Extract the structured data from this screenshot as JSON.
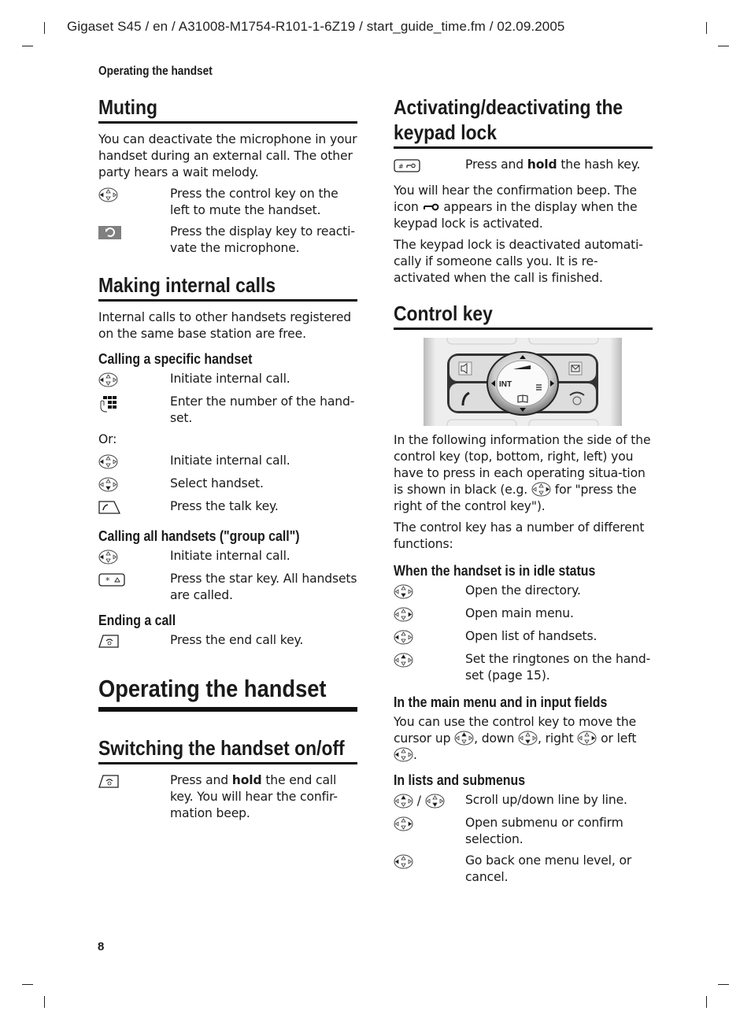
{
  "page_header": "Gigaset S45 / en / A31008-M1754-R101-1-6Z19 / start_guide_time.fm / 02.09.2005",
  "running_head": "Operating the handset",
  "page_number": "8",
  "left": {
    "muting": {
      "title": "Muting",
      "intro": "You can deactivate the microphone in your handset during an external call. The other party hears a wait melody.",
      "steps": [
        {
          "icon": "control-key-left-icon",
          "text": "Press the control key on the left to mute the handset."
        },
        {
          "icon": "display-key-back-icon",
          "text": "Press the display key to reacti-vate the microphone."
        }
      ]
    },
    "internal": {
      "title": "Making internal calls",
      "intro": "Internal calls to other handsets registered on the same base station are free.",
      "specific": {
        "title": "Calling a specific handset",
        "steps": [
          {
            "icon": "control-key-left-icon",
            "text": "Initiate internal call."
          },
          {
            "icon": "keypad-icon",
            "text": "Enter the number of the hand-set."
          }
        ],
        "or": "Or:",
        "steps2": [
          {
            "icon": "control-key-left-icon",
            "text": "Initiate internal call."
          },
          {
            "icon": "control-key-down-icon",
            "text": "Select handset."
          },
          {
            "icon": "talk-key-icon",
            "text": "Press the talk key."
          }
        ]
      },
      "group": {
        "title": "Calling all handsets (\"group call\")",
        "steps": [
          {
            "icon": "control-key-left-icon",
            "text": "Initiate internal call."
          },
          {
            "icon": "star-key-icon",
            "text": "Press the star key. All handsets are called."
          }
        ]
      },
      "ending": {
        "title": "Ending a call",
        "steps": [
          {
            "icon": "end-call-key-icon",
            "text": "Press the end call key."
          }
        ]
      }
    },
    "operating": {
      "title": "Operating the handset"
    },
    "switching": {
      "title": "Switching the handset on/off",
      "step": {
        "icon": "end-call-key-icon",
        "text_pre": "Press and ",
        "text_bold": "hold",
        "text_post": " the end call key. You will hear the confir-mation beep."
      }
    }
  },
  "right": {
    "keypad_lock": {
      "title_line1": "Activating/deactivating the",
      "title_line2": "keypad lock",
      "step": {
        "icon": "hash-key-icon",
        "text_pre": "Press and ",
        "text_bold": "hold",
        "text_post": " the hash key."
      },
      "p1_pre": "You will hear the confirmation beep. The icon ",
      "p1_icon": "key-lock-icon",
      "p1_post": " appears in the display when the keypad lock is activated.",
      "p2": "The keypad lock is deactivated automati-cally if someone calls you. It is re-activated when the call is finished."
    },
    "control_key": {
      "title": "Control key",
      "image_labels": {
        "int": "INT"
      },
      "p1_pre": "In the following information the side of the control key (top, bottom, right, left) you have to press in each operating situa-tion is shown in black (e.g. ",
      "p1_post": " for \"press the right of the control key\").",
      "p2": "The control key has a number of different functions:",
      "idle": {
        "title": "When the handset is in idle status",
        "steps": [
          {
            "icon": "control-key-down-icon",
            "text": "Open the directory."
          },
          {
            "icon": "control-key-right-icon",
            "text": "Open main menu."
          },
          {
            "icon": "control-key-left-icon",
            "text": "Open list of handsets."
          },
          {
            "icon": "control-key-up-icon",
            "text": "Set the ringtones on the hand-set (page 15)."
          }
        ]
      },
      "menu": {
        "title": "In the main menu and in input fields",
        "t1": "You can use the control key to move the cursor up ",
        "t2": ", down ",
        "t3": ", right ",
        "t4": " or left ",
        "t5": "."
      },
      "lists": {
        "title": "In lists and submenus",
        "slash": " / ",
        "steps": [
          {
            "icon": "control-key-up-down-icon",
            "text": "Scroll up/down line by line."
          },
          {
            "icon": "control-key-right-icon",
            "text": "Open submenu or confirm selection."
          },
          {
            "icon": "control-key-left-icon",
            "text": "Go back one menu level, or cancel."
          }
        ]
      }
    }
  }
}
